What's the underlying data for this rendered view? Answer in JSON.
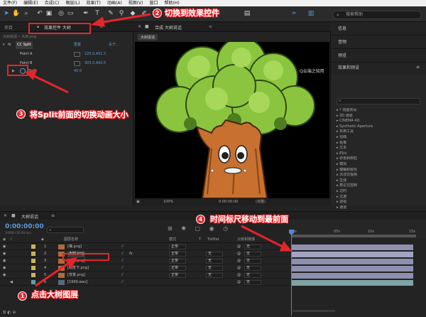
{
  "menu": [
    "文件(F)",
    "编辑(E)",
    "合成(C)",
    "图层(L)",
    "效果(T)",
    "动画(A)",
    "视图(V)",
    "窗口",
    "帮助(H)"
  ],
  "toolbar": {
    "tools": [
      "selection-tool-icon",
      "hand-tool-icon",
      "zoom-tool-icon",
      "rotate-tool-icon",
      "camera-tool-icon",
      "pan-behind-tool-icon",
      "pen-tool-icon",
      "type-tool-icon",
      "brush-tool-icon",
      "clone-stamp-icon",
      "eraser-tool-icon",
      "roto-brush-icon",
      "puppet-pin-icon"
    ],
    "search_placeholder": "搜索帮助"
  },
  "left_panel": {
    "tabs": {
      "project": "项目",
      "effect_controls": "效果控件 大树"
    },
    "tab_menu_icon": "≡",
    "subtitle": "大树说话 • 大树.png",
    "effect": {
      "fx": "fx",
      "name": "CC Split",
      "reset": "重置",
      "about": "关于..."
    },
    "params": [
      {
        "name": "Point A",
        "value": "225.0,401.5"
      },
      {
        "name": "Point B",
        "value": "305.0,400.5"
      },
      {
        "name": "Split",
        "value": "40.0"
      }
    ]
  },
  "comp_panel": {
    "tab": "合成 大树说话",
    "comp_name": "大树说话",
    "watermark": "Q云端之知用",
    "footer": {
      "zoom": "100%",
      "time": "0:00:00:00",
      "resolution": "(完整)"
    }
  },
  "right_panel": {
    "sections": [
      "信息",
      "音频",
      "预览",
      "效果和预设"
    ],
    "menu_icon": "≡",
    "effects": [
      "* 动画预设",
      "3D 通道",
      "CINEMA 4D",
      "Synthetic Aperture",
      "实用工具",
      "扭曲",
      "抠像",
      "文本",
      "时间",
      "杂色和颗粒",
      "模拟",
      "模糊和锐化",
      "沉浸式视频",
      "生成",
      "表达式控制",
      "过时",
      "过渡",
      "透视",
      "通道"
    ]
  },
  "timeline": {
    "comp_tab": "大树说话",
    "timecode": "0:00:00:00",
    "fps": "00000 (30.00 fps)",
    "ruler_labels": [
      "0s",
      "05s",
      "10s",
      "15s"
    ],
    "columns": {
      "name": "图层名称",
      "mode": "模式",
      "t": "T",
      "trkmat": "TrkMat",
      "parent": "父级和链接"
    },
    "layers": [
      {
        "num": "1",
        "name": "[嘴.png]",
        "mode": "正常",
        "trkmat": "",
        "parent": "无"
      },
      {
        "num": "2",
        "name": "大树 png",
        "mode": "正常",
        "trkmat": "无",
        "parent": "无"
      },
      {
        "num": "3",
        "name": "[眼睛.png]",
        "mode": "正常",
        "trkmat": "无",
        "parent": "无"
      },
      {
        "num": "4",
        "name": "[眼皮下.png]",
        "mode": "正常",
        "trkmat": "无",
        "parent": "无"
      },
      {
        "num": "5",
        "name": "[背景.png]",
        "mode": "正常",
        "trkmat": "无",
        "parent": "无"
      },
      {
        "num": "6",
        "name": "[1999.wav]",
        "mode": "",
        "trkmat": "",
        "parent": "无"
      }
    ]
  },
  "annotations": [
    {
      "num": "1",
      "text": "点击大树图层"
    },
    {
      "num": "2",
      "text": "切换到效果控件"
    },
    {
      "num": "3",
      "text": "将Split前面的切换动画大小"
    },
    {
      "num": "4",
      "text": "时间标尺移动到最前面"
    }
  ],
  "colors": {
    "accent": "#e5252a",
    "value_blue": "#5c9ad8",
    "track": "#8f8fb0"
  }
}
